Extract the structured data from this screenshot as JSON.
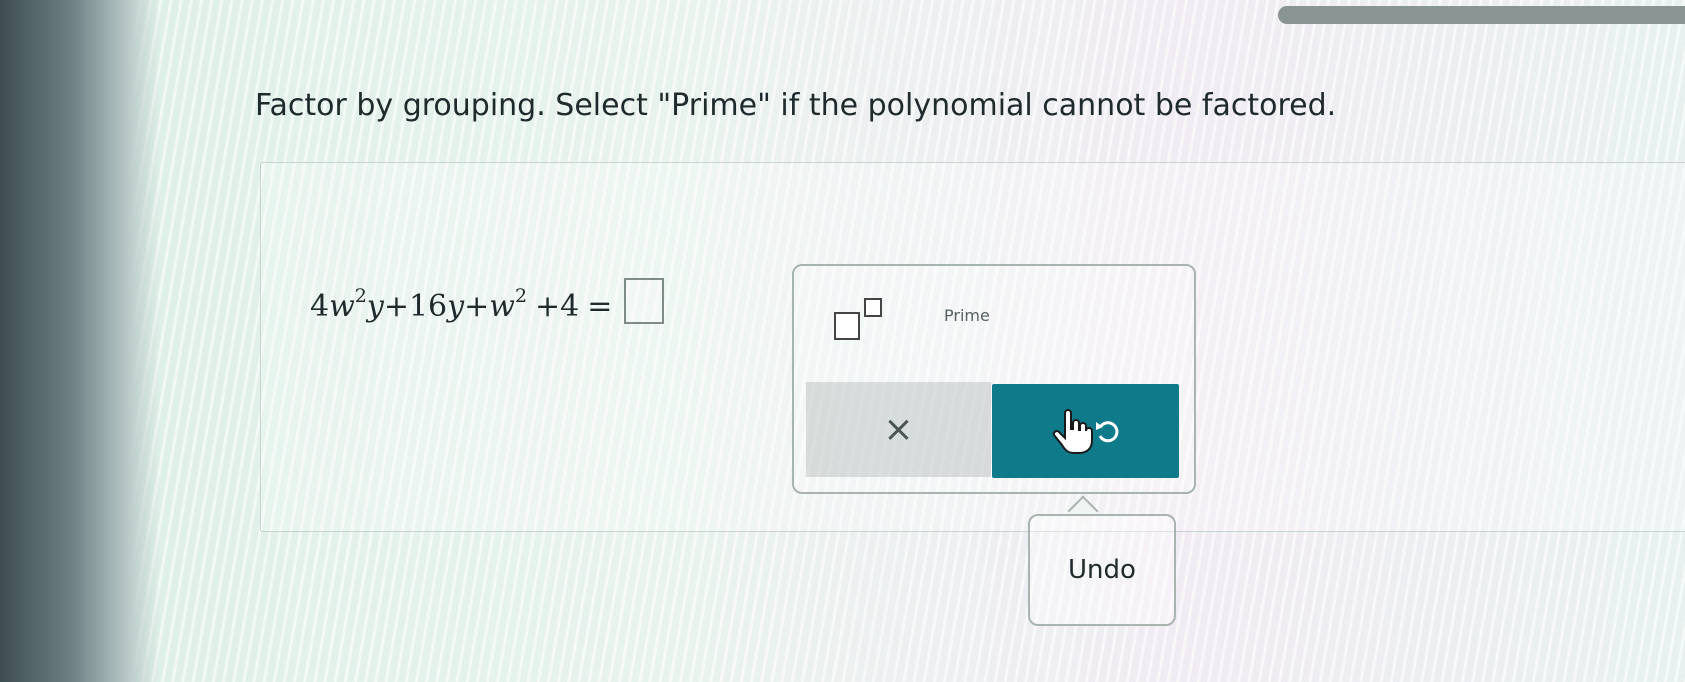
{
  "question": {
    "instructions": "Factor by grouping. Select \"Prime\" if the polynomial cannot be factored."
  },
  "equation": {
    "t1_coef": "4",
    "t1_var1": "w",
    "t1_exp": "2",
    "t1_var2": "y",
    "op1": "+",
    "t2_coef": "16",
    "t2_var": "y",
    "op2": "+",
    "t3_var": "w",
    "t3_exp": "2",
    "op3": "+",
    "t4": "4",
    "equals": "="
  },
  "toolbox": {
    "prime_label": "Prime",
    "clear_symbol": "×"
  },
  "tooltip": {
    "undo_label": "Undo"
  },
  "icons": {
    "exponent": "exponent-template-icon",
    "hand": "hand-pointer-icon",
    "undo": "undo-icon"
  },
  "colors": {
    "undo_button": "#0f7b8a"
  }
}
